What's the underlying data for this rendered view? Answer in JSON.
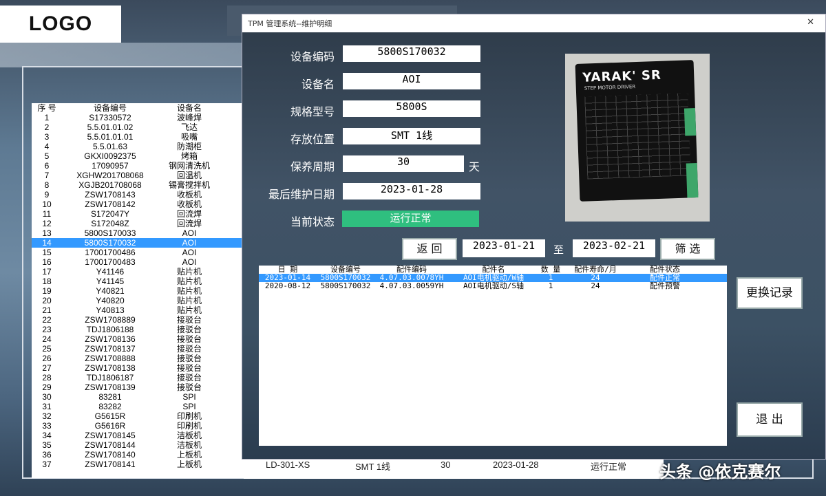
{
  "logo": "LOGO",
  "list": {
    "headers": [
      "序 号",
      "设备编号",
      "设备名"
    ],
    "selected_index": 13,
    "rows": [
      [
        "1",
        "S17330572",
        "波峰焊"
      ],
      [
        "2",
        "5.5.01.01.02",
        "飞达"
      ],
      [
        "3",
        "5.5.01.01.01",
        "吸嘴"
      ],
      [
        "4",
        "5.5.01.63",
        "防潮柜"
      ],
      [
        "5",
        "GKXI0092375",
        "烤箱"
      ],
      [
        "6",
        "17090957",
        "钢网清洗机"
      ],
      [
        "7",
        "XGHW201708068",
        "回温机"
      ],
      [
        "8",
        "XGJB201708068",
        "锡膏搅拌机"
      ],
      [
        "9",
        "ZSW1708143",
        "收板机"
      ],
      [
        "10",
        "ZSW1708142",
        "收板机"
      ],
      [
        "11",
        "S172047Y",
        "回流焊"
      ],
      [
        "12",
        "S172048Z",
        "回流焊"
      ],
      [
        "13",
        "5800S170033",
        "AOI"
      ],
      [
        "14",
        "5800S170032",
        "AOI"
      ],
      [
        "15",
        "17001700486",
        "AOI"
      ],
      [
        "16",
        "17001700483",
        "AOI"
      ],
      [
        "17",
        "Y41146",
        "贴片机"
      ],
      [
        "18",
        "Y41145",
        "贴片机"
      ],
      [
        "19",
        "Y40821",
        "贴片机"
      ],
      [
        "20",
        "Y40820",
        "贴片机"
      ],
      [
        "21",
        "Y40813",
        "贴片机"
      ],
      [
        "22",
        "ZSW1708889",
        "接驳台"
      ],
      [
        "23",
        "TDJ1806188",
        "接驳台"
      ],
      [
        "24",
        "ZSW1708136",
        "接驳台"
      ],
      [
        "25",
        "ZSW1708137",
        "接驳台"
      ],
      [
        "26",
        "ZSW1708888",
        "接驳台"
      ],
      [
        "27",
        "ZSW1708138",
        "接驳台"
      ],
      [
        "28",
        "TDJ1806187",
        "接驳台"
      ],
      [
        "29",
        "ZSW1708139",
        "接驳台"
      ],
      [
        "30",
        "83281",
        "SPI"
      ],
      [
        "31",
        "83282",
        "SPI"
      ],
      [
        "32",
        "G5615R",
        "印刷机"
      ],
      [
        "33",
        "G5616R",
        "印刷机"
      ],
      [
        "34",
        "ZSW1708145",
        "洁板机"
      ],
      [
        "35",
        "ZSW1708144",
        "洁板机"
      ],
      [
        "36",
        "ZSW1708140",
        "上板机"
      ],
      [
        "37",
        "ZSW1708141",
        "上板机"
      ]
    ]
  },
  "bgstrip": {
    "model": "LD-301-XS",
    "location": "SMT 1线",
    "cycle": "30",
    "date": "2023-01-28",
    "status": "运行正常"
  },
  "dialog": {
    "title": "TPM 管理系统--维护明细",
    "close": "✕",
    "fields": {
      "code_label": "设备编码",
      "code": "5800S170032",
      "name_label": "设备名",
      "name": "AOI",
      "model_label": "规格型号",
      "model": "5800S",
      "location_label": "存放位置",
      "location": "SMT 1线",
      "cycle_label": "保养周期",
      "cycle": "30",
      "cycle_unit": "天",
      "last_label": "最后维护日期",
      "last": "2023-01-28",
      "status_label": "当前状态",
      "status": "运行正常"
    },
    "photo": {
      "brand": "YARAK' SR",
      "sub": "STEP MOTOR DRIVER"
    },
    "filter": {
      "back": "返 回",
      "from": "2023-01-21",
      "to_label": "至",
      "to": "2023-02-21",
      "filter": "筛 选"
    },
    "table": {
      "headers": [
        "日 期",
        "设备编号",
        "配件编码",
        "配件名",
        "数 量",
        "配件寿命/月",
        "配件状态"
      ],
      "rows": [
        [
          "2023-01-14",
          "5800S170032",
          "4.07.03.0078YH",
          "AOI电机驱动/W轴",
          "1",
          "24",
          "配件正常"
        ],
        [
          "2020-08-12",
          "5800S170032",
          "4.07.03.0059YH",
          "AOI电机驱动/S轴",
          "1",
          "24",
          "配件预警"
        ]
      ]
    },
    "replace_btn": "更换记录",
    "exit_btn": "退 出"
  },
  "watermark": "头条 @依克赛尔",
  "colors": {
    "selection": "#3399ff",
    "status_ok": "#2fbf7f"
  }
}
